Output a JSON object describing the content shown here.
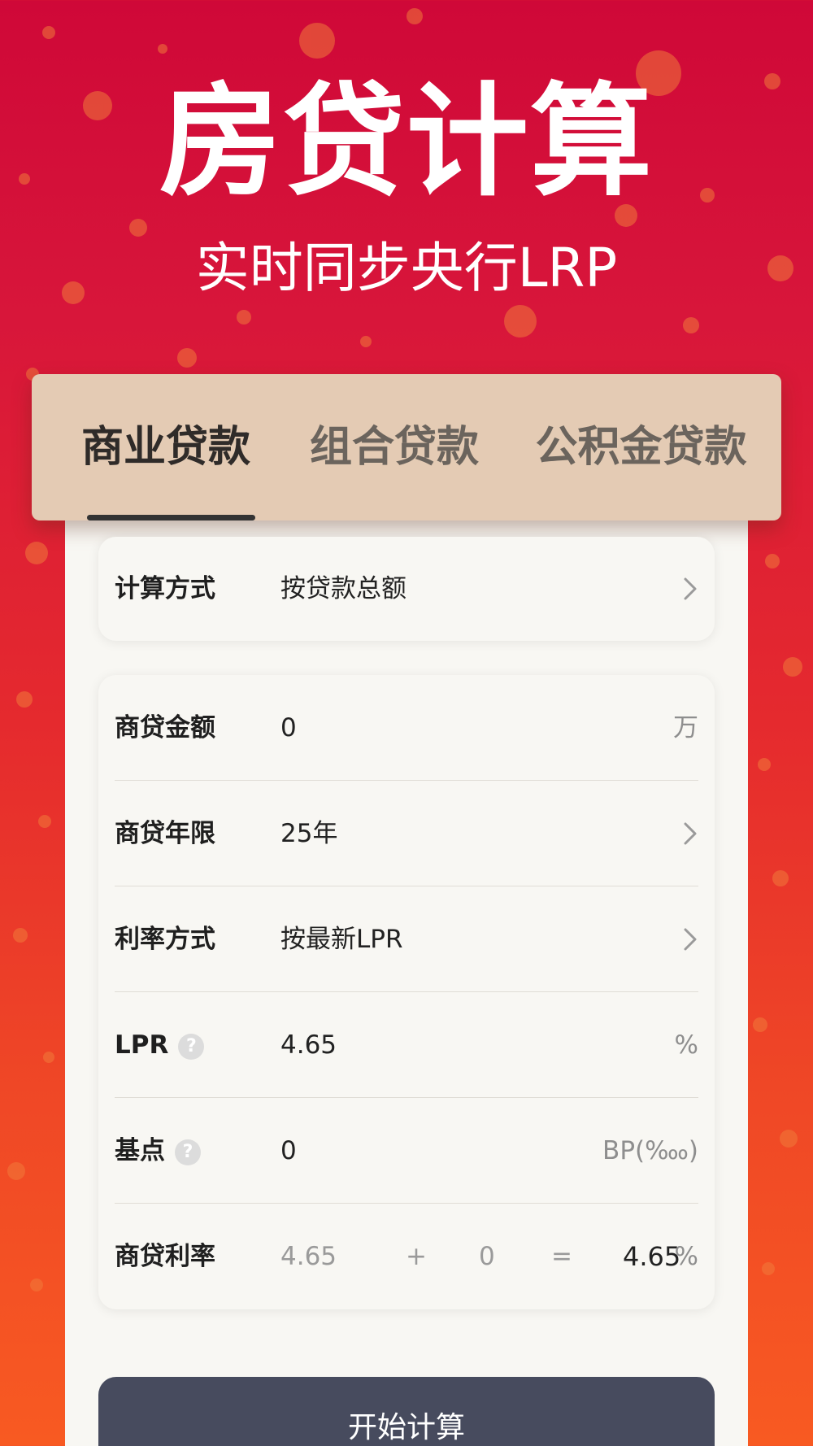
{
  "hero": {
    "title": "房贷计算",
    "subtitle": "实时同步央行LRP"
  },
  "tabs": [
    {
      "label": "商业贷款",
      "active": true
    },
    {
      "label": "组合贷款",
      "active": false
    },
    {
      "label": "公积金贷款",
      "active": false
    }
  ],
  "method": {
    "label": "计算方式",
    "value": "按贷款总额"
  },
  "form": {
    "amount": {
      "label": "商贷金额",
      "value": "0",
      "unit": "万"
    },
    "term": {
      "label": "商贷年限",
      "value": "25年"
    },
    "rate_mode": {
      "label": "利率方式",
      "value": "按最新LPR"
    },
    "lpr": {
      "label": "LPR",
      "value": "4.65",
      "unit": "%"
    },
    "bp": {
      "label": "基点",
      "value": "0",
      "unit": "BP(‱)"
    },
    "rate": {
      "label": "商贷利率",
      "lpr": "4.65",
      "plus": "+",
      "bp": "0",
      "equals": "=",
      "result": "4.65",
      "unit": "%"
    }
  },
  "help_icon": "question-icon",
  "chevron_icon": "chevron-right-icon",
  "start_button": "开始计算",
  "colors": {
    "background_top": "#cf0838",
    "background_bottom": "#f85a22",
    "tab_bar": "#e4cbb4",
    "card": "#f8f7f3",
    "button": "#474b5e"
  }
}
